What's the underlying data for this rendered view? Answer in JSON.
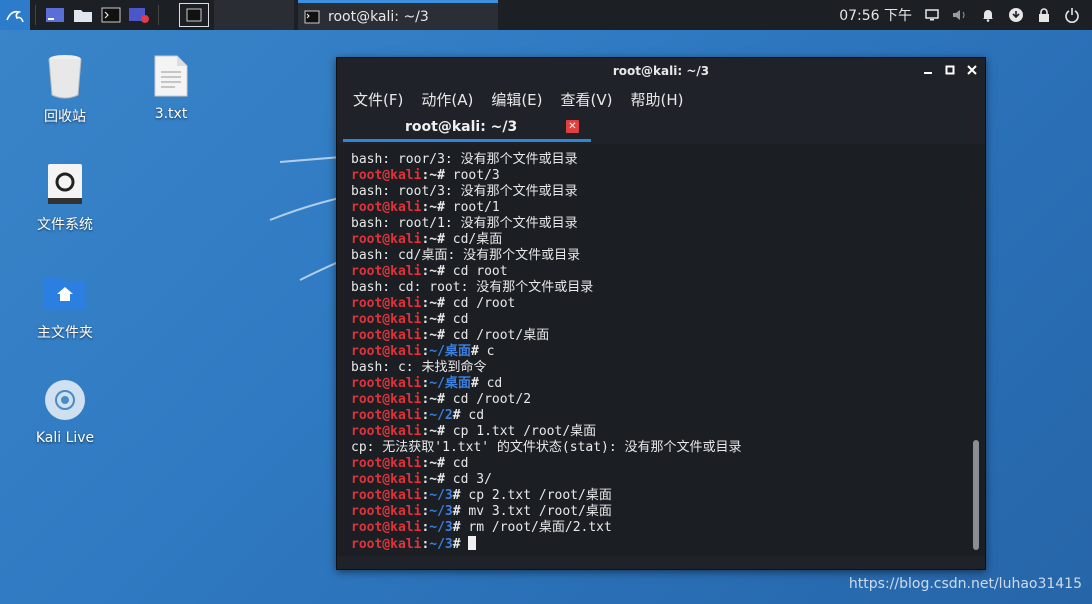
{
  "taskbar": {
    "clock": "07:56 下午",
    "window_button_label": "root@kali: ~/3"
  },
  "desktop": {
    "icons": [
      {
        "label": "回收站"
      },
      {
        "label": "3.txt"
      },
      {
        "label": "文件系统"
      },
      {
        "label": "主文件夹"
      },
      {
        "label": "Kali Live"
      }
    ]
  },
  "terminal": {
    "title": "root@kali: ~/3",
    "menu": [
      "文件(F)",
      "动作(A)",
      "编辑(E)",
      "查看(V)",
      "帮助(H)"
    ],
    "tab_label": "root@kali: ~/3",
    "prompt_user": "root@kali",
    "lines": [
      {
        "type": "out",
        "text": "bash: roor/3: 没有那个文件或目录"
      },
      {
        "type": "cmd",
        "path": "~",
        "text": "root/3"
      },
      {
        "type": "out",
        "text": "bash: root/3: 没有那个文件或目录"
      },
      {
        "type": "cmd",
        "path": "~",
        "text": "root/1"
      },
      {
        "type": "out",
        "text": "bash: root/1: 没有那个文件或目录"
      },
      {
        "type": "cmd",
        "path": "~",
        "text": "cd/桌面"
      },
      {
        "type": "out",
        "text": "bash: cd/桌面: 没有那个文件或目录"
      },
      {
        "type": "cmd",
        "path": "~",
        "text": "cd root"
      },
      {
        "type": "out",
        "text": "bash: cd: root: 没有那个文件或目录"
      },
      {
        "type": "cmd",
        "path": "~",
        "text": "cd /root"
      },
      {
        "type": "cmd",
        "path": "~",
        "text": "cd"
      },
      {
        "type": "cmd",
        "path": "~",
        "text": "cd /root/桌面"
      },
      {
        "type": "cmd",
        "path": "~/桌面",
        "text": "c"
      },
      {
        "type": "out",
        "text": "bash: c: 未找到命令"
      },
      {
        "type": "cmd",
        "path": "~/桌面",
        "text": "cd"
      },
      {
        "type": "cmd",
        "path": "~",
        "text": "cd /root/2"
      },
      {
        "type": "cmd",
        "path": "~/2",
        "text": "cd"
      },
      {
        "type": "cmd",
        "path": "~",
        "text": "cp 1.txt /root/桌面"
      },
      {
        "type": "out",
        "text": "cp: 无法获取'1.txt' 的文件状态(stat): 没有那个文件或目录"
      },
      {
        "type": "cmd",
        "path": "~",
        "text": "cd"
      },
      {
        "type": "cmd",
        "path": "~",
        "text": "cd 3/"
      },
      {
        "type": "cmd",
        "path": "~/3",
        "text": "cp 2.txt /root/桌面"
      },
      {
        "type": "cmd",
        "path": "~/3",
        "text": "mv 3.txt /root/桌面"
      },
      {
        "type": "cmd",
        "path": "~/3",
        "text": "rm /root/桌面/2.txt"
      },
      {
        "type": "cmd",
        "path": "~/3",
        "text": "",
        "cursor": true
      }
    ]
  },
  "watermark": "https://blog.csdn.net/luhao31415",
  "colors": {
    "prompt_user": "#e0323a",
    "prompt_path": "#3a7fe0",
    "accent": "#2f86d9"
  }
}
